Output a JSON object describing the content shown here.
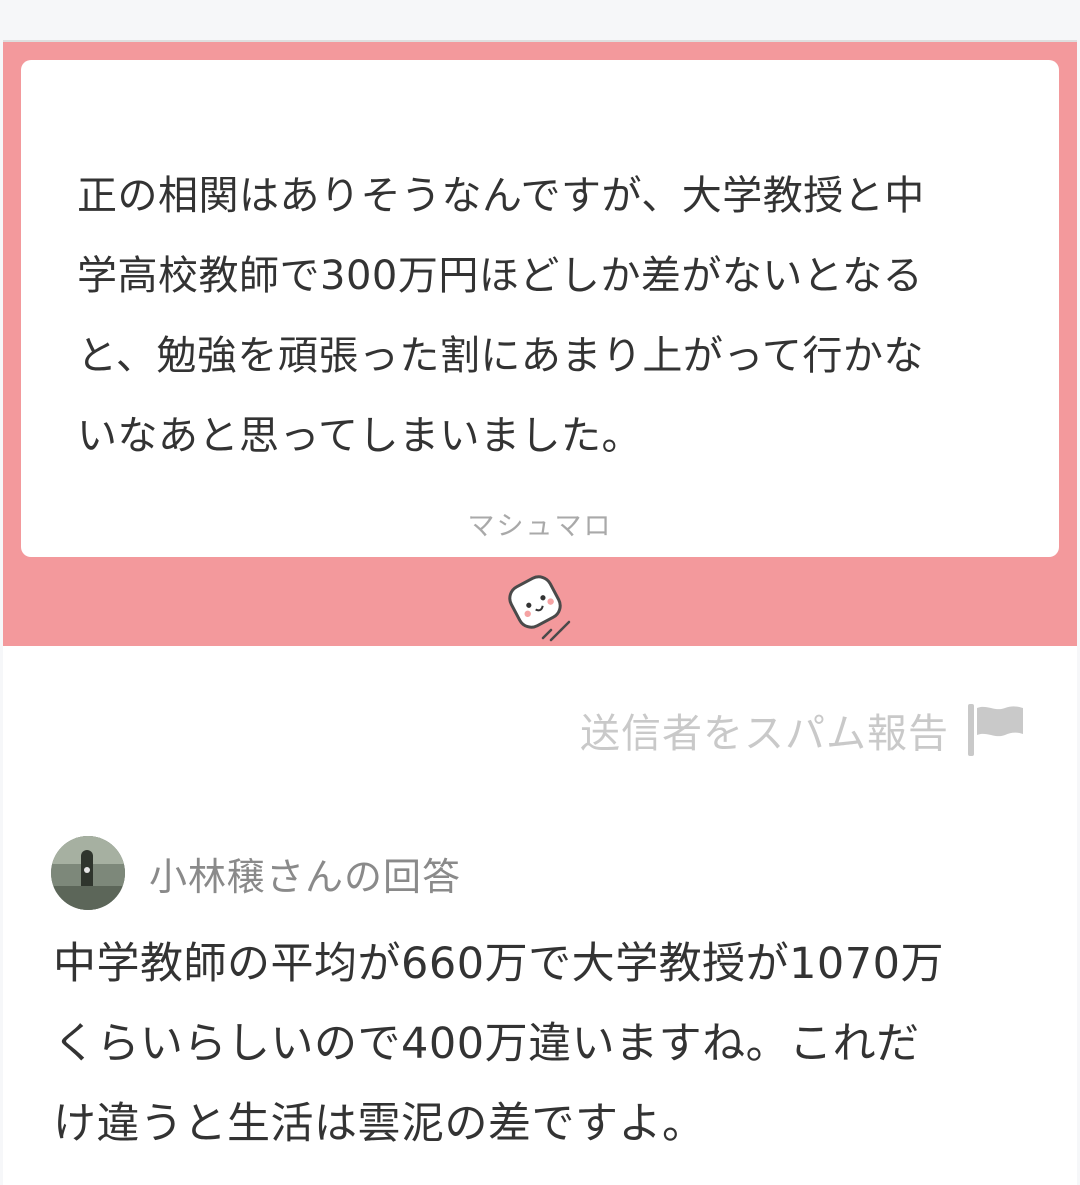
{
  "question": {
    "text": "正の相関はありそうなんですが、大学教授と中\n学高校教師で300万円ほどしか差がないとなる\nと、勉強を頑張った割にあまり上がって行かな\nいなあと思ってしまいました。",
    "brand_label": "マシュマロ",
    "mascot_icon": "marshmallow-mascot-icon"
  },
  "report": {
    "label": "送信者をスパム報告",
    "icon": "flag-icon"
  },
  "answer": {
    "header": "小林穣さんの回答",
    "avatar_icon": "user-avatar",
    "text": "中学教師の平均が660万で大学教授が1070万\nくらいらしいので400万違いますね。これだ\nけ違うと生活は雲泥の差ですよ。"
  },
  "colors": {
    "accent": "#f3999c",
    "text": "#333333",
    "muted": "#a9a9a9"
  }
}
